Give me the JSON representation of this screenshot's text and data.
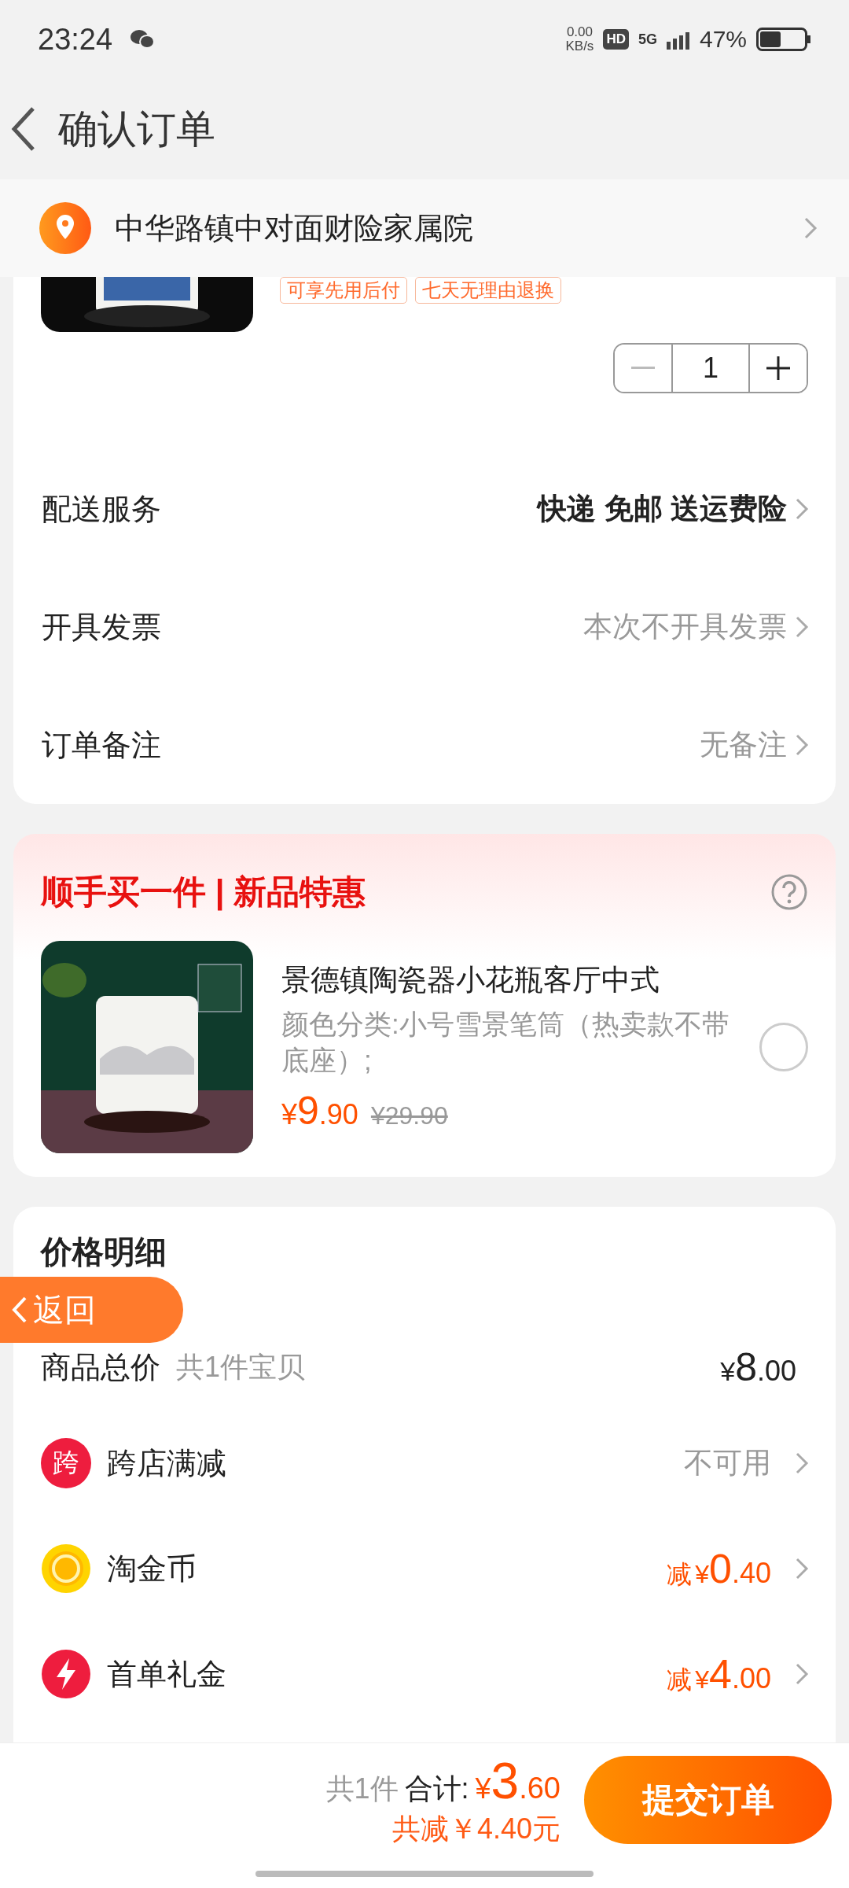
{
  "status_bar": {
    "time": "23:24",
    "net_speed": "0.00",
    "net_unit": "KB/s",
    "hd": "HD",
    "network": "5G",
    "battery": "47%"
  },
  "header": {
    "title": "确认订单"
  },
  "address": {
    "text": "中华路镇中对面财险家属院"
  },
  "order_item": {
    "tags": [
      "可享先用后付",
      "七天无理由退换"
    ],
    "quantity": "1",
    "minus_disabled": true
  },
  "order_rows": [
    {
      "label": "配送服务",
      "value": "快递 免邮 送运费险",
      "emphasis": true
    },
    {
      "label": "开具发票",
      "value": "本次不开具发票",
      "emphasis": false
    },
    {
      "label": "订单备注",
      "value": "无备注",
      "emphasis": false
    }
  ],
  "addon": {
    "title": "顺手买一件 | 新品特惠",
    "name": "景德镇陶瓷器小花瓶客厅中式",
    "spec": "颜色分类:小号雪景笔筒（热卖款不带底座）;",
    "price": {
      "currency": "¥",
      "integer": "9",
      "decimal": ".90"
    },
    "original_price": "¥29.90",
    "selected": false
  },
  "price_detail": {
    "title": "价格明细",
    "total_label": "商品总价",
    "total_count": "共1件宝贝",
    "total": {
      "currency": "¥",
      "integer": "8",
      "decimal": ".00"
    },
    "rows": [
      {
        "kind": "cross",
        "icon_text": "跨",
        "label": "跨店满减",
        "value": "不可用"
      },
      {
        "kind": "coin",
        "label": "淘金币",
        "prefix": "减",
        "value": {
          "currency": "¥",
          "integer": "0",
          "decimal": ".40"
        }
      },
      {
        "kind": "bolt",
        "label": "首单礼金",
        "prefix": "减",
        "value": {
          "currency": "¥",
          "integer": "4",
          "decimal": ".00"
        }
      }
    ]
  },
  "back_float": {
    "label": "返回"
  },
  "footer": {
    "count": "共1件",
    "total_label": "合计:",
    "total": {
      "currency": "¥",
      "integer": "3",
      "decimal": ".60"
    },
    "saved": "共减￥4.40元",
    "submit": "提交订单"
  }
}
